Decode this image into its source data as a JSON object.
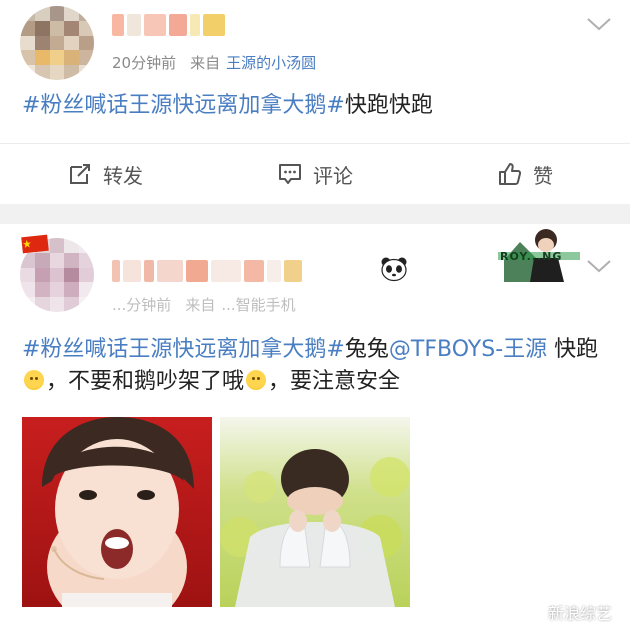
{
  "post1": {
    "meta": {
      "time": "20分钟前",
      "from_prefix": "来自",
      "source": "王源的小汤圆"
    },
    "text": {
      "tag": "#粉丝喊话王源快远离加拿大鹅#",
      "rest": "快跑快跑"
    },
    "actions": {
      "repost": "转发",
      "comment": "评论",
      "like": "赞"
    }
  },
  "post2": {
    "meta": {
      "time": "...分钟前",
      "from_prefix": "来自",
      "source": "...智能手机"
    },
    "badge": {
      "text": "ROY...NG"
    },
    "text": {
      "tag1": "#粉丝喊话王源快远离加拿大鹅#",
      "part1": "兔兔",
      "mention": "@TFBOYS-王源",
      "part2": " 快跑",
      "part3": "，不要和鹅吵架了哦",
      "part4": "，要注意安全"
    }
  },
  "watermark": {
    "text": "新浪综艺"
  },
  "colors": {
    "link": "#4a7ec2",
    "meta": "#8a8a8a",
    "divider": "#f1f1f1"
  }
}
